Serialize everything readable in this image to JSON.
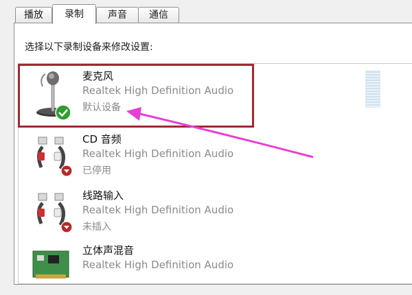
{
  "tabs": [
    {
      "label": "播放",
      "active": false
    },
    {
      "label": "录制",
      "active": true
    },
    {
      "label": "声音",
      "active": false
    },
    {
      "label": "通信",
      "active": false
    }
  ],
  "instruction": "选择以下录制设备来修改设置:",
  "devices": [
    {
      "name": "麦克风",
      "driver": "Realtek High Definition Audio",
      "status": "默认设备",
      "icon": "microphone-icon",
      "badge": "check-badge-icon"
    },
    {
      "name": "CD 音频",
      "driver": "Realtek High Definition Audio",
      "status": "已停用",
      "icon": "rca-cable-icon",
      "badge": "disabled-down-arrow-icon"
    },
    {
      "name": "线路输入",
      "driver": "Realtek High Definition Audio",
      "status": "未插入",
      "icon": "rca-cable-icon",
      "badge": "unplugged-down-arrow-icon"
    },
    {
      "name": "立体声混音",
      "driver": "Realtek High Definition Audio",
      "status": "",
      "icon": "sound-card-icon",
      "badge": ""
    }
  ],
  "colors": {
    "highlight_box": "#9d2a31",
    "annotation_arrow": "#e73ed6",
    "default_badge": "#2f9e2f",
    "disabled_badge": "#b52a2a"
  }
}
